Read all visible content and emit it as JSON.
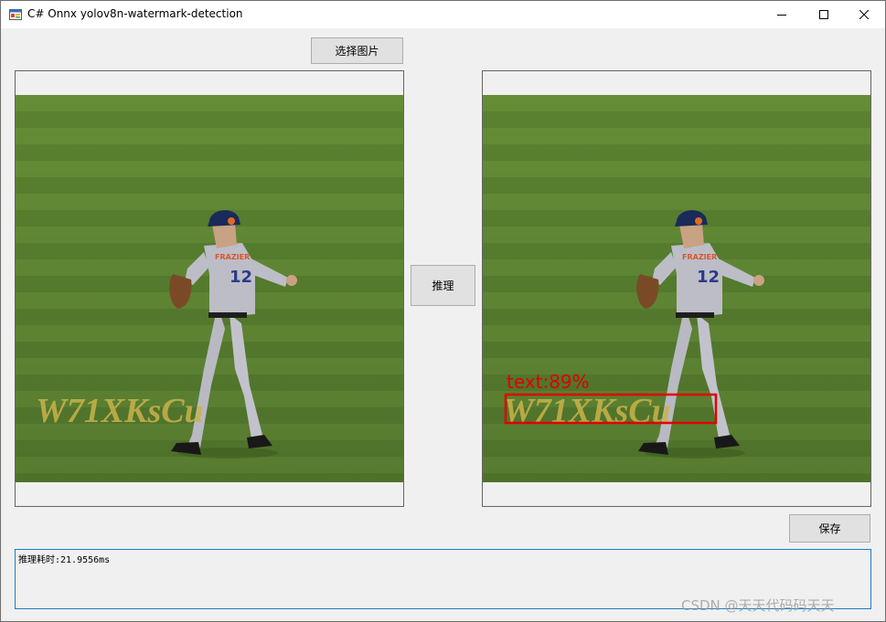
{
  "window": {
    "title": "C# Onnx yolov8n-watermark-detection"
  },
  "toolbar": {
    "select_image_label": "选择图片",
    "infer_label": "推理",
    "save_label": "保存"
  },
  "images": {
    "watermark_text": "W71XKsCu",
    "detection_label": "text:89%"
  },
  "log": {
    "text": "推理耗时:21.9556ms"
  },
  "credit": {
    "text": "CSDN @天天代码码天天"
  },
  "colors": {
    "detection_box": "#e00000",
    "grass_light": "#6f9a3c",
    "grass_dark": "#5a8530",
    "watermark": "#c9b34a"
  }
}
